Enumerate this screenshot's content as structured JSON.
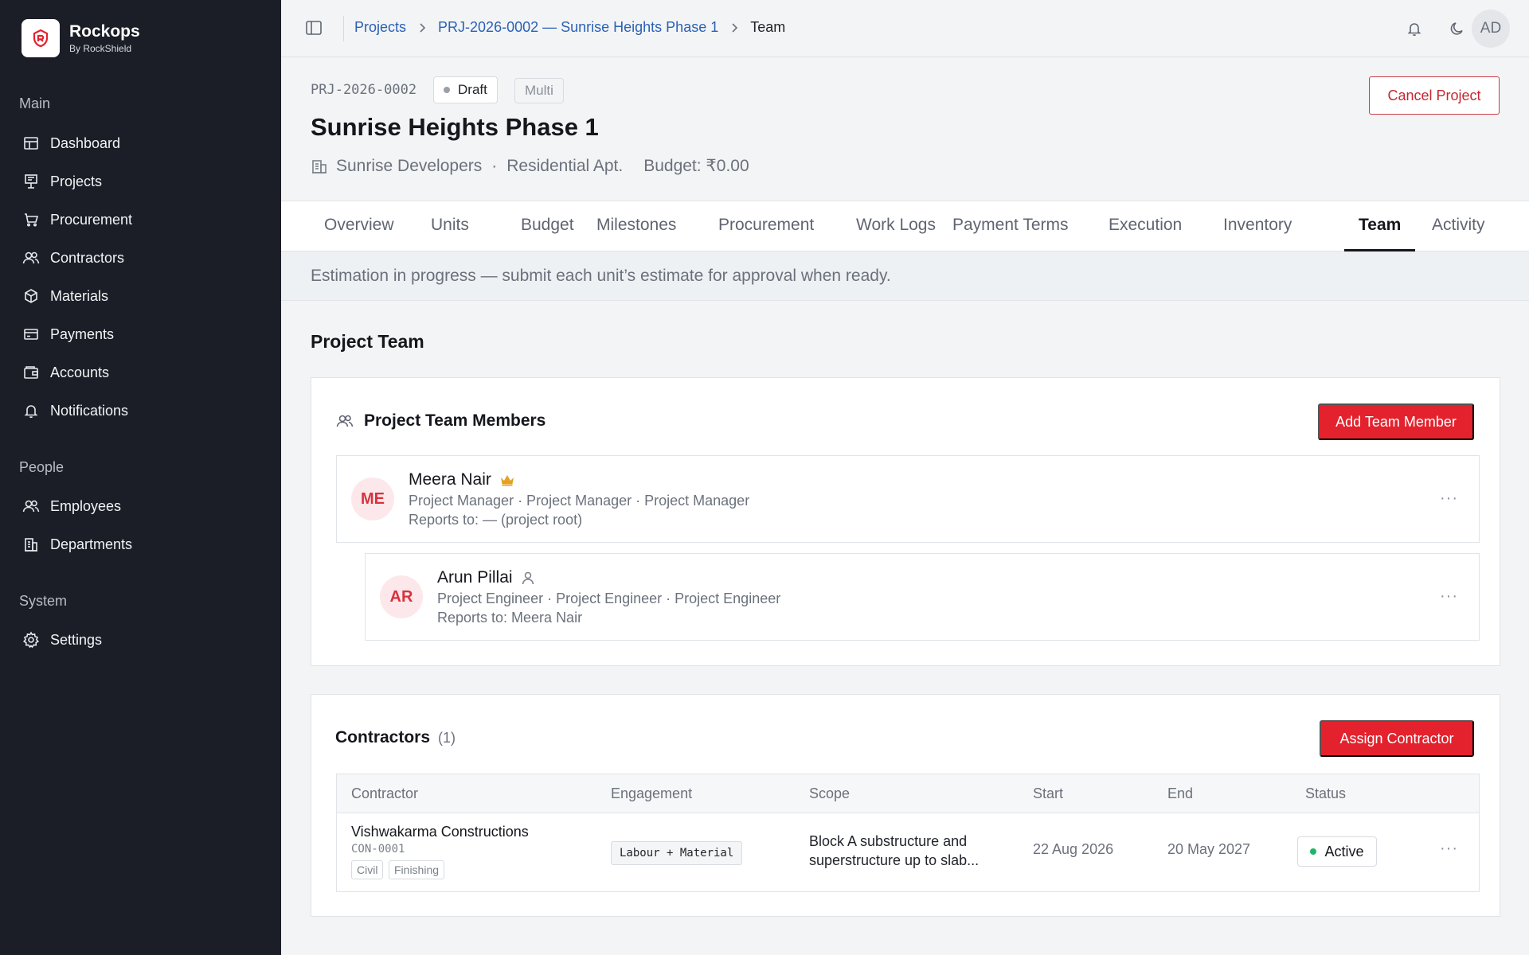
{
  "brand": {
    "name": "Rockops",
    "sub": "By RockShield"
  },
  "sidebar": {
    "sections": [
      {
        "label": "Main"
      },
      {
        "label": "People"
      },
      {
        "label": "System"
      }
    ],
    "items": [
      {
        "label": "Dashboard",
        "icon": "dashboard-icon"
      },
      {
        "label": "Projects",
        "icon": "projects-icon"
      },
      {
        "label": "Procurement",
        "icon": "cart-icon"
      },
      {
        "label": "Contractors",
        "icon": "contractors-icon"
      },
      {
        "label": "Materials",
        "icon": "box-icon"
      },
      {
        "label": "Payments",
        "icon": "card-icon"
      },
      {
        "label": "Accounts",
        "icon": "wallet-icon"
      },
      {
        "label": "Notifications",
        "icon": "bell-icon"
      },
      {
        "label": "Employees",
        "icon": "users-icon"
      },
      {
        "label": "Departments",
        "icon": "building-icon"
      },
      {
        "label": "Settings",
        "icon": "gear-icon"
      }
    ]
  },
  "breadcrumb": {
    "items": [
      "Projects",
      "PRJ-2026-0002 — Sunrise Heights Phase 1"
    ],
    "current": "Team"
  },
  "user": {
    "initials": "AD"
  },
  "project": {
    "code": "PRJ-2026-0002",
    "status": "Draft",
    "mode": "Multi",
    "title": "Sunrise Heights Phase 1",
    "client": "Sunrise Developers",
    "type": "Residential Apt.",
    "budget": "Budget: ₹0.00",
    "cancel_label": "Cancel Project"
  },
  "tabs": [
    "Overview",
    "Units",
    "Budget",
    "Milestones",
    "Procurement",
    "Work Logs",
    "Payment Terms",
    "Execution",
    "Inventory",
    "Team",
    "Activity"
  ],
  "active_tab": "Team",
  "notice": "Estimation in progress — submit each unit’s estimate for approval when ready.",
  "team": {
    "section_title": "Project Team",
    "card_title": "Project Team Members",
    "add_label": "Add Team Member",
    "members": [
      {
        "initials": "ME",
        "name": "Meera Nair",
        "role": "Project Manager · Project Manager · Project Manager",
        "reports": "Reports to: — (project root)",
        "icon": "crown-icon"
      },
      {
        "initials": "AR",
        "name": "Arun Pillai",
        "role": "Project Engineer · Project Engineer · Project Engineer",
        "reports": "Reports to: Meera Nair",
        "icon": "user-icon"
      }
    ]
  },
  "contractors": {
    "title": "Contractors",
    "count": "(1)",
    "assign_label": "Assign Contractor",
    "columns": [
      "Contractor",
      "Engagement",
      "Scope",
      "Start",
      "End",
      "Status"
    ],
    "rows": [
      {
        "name": "Vishwakarma Constructions",
        "code": "CON-0001",
        "tags": [
          "Civil",
          "Finishing"
        ],
        "engagement": "Labour + Material",
        "scope": "Block A substructure and superstructure up to slab...",
        "start": "22 Aug 2026",
        "end": "20 May 2027",
        "status": "Active"
      }
    ]
  },
  "colors": {
    "accent": "#e3222d",
    "sidebar": "#1b1e26",
    "link": "#2b61b6",
    "active_status": "#1fb566"
  }
}
